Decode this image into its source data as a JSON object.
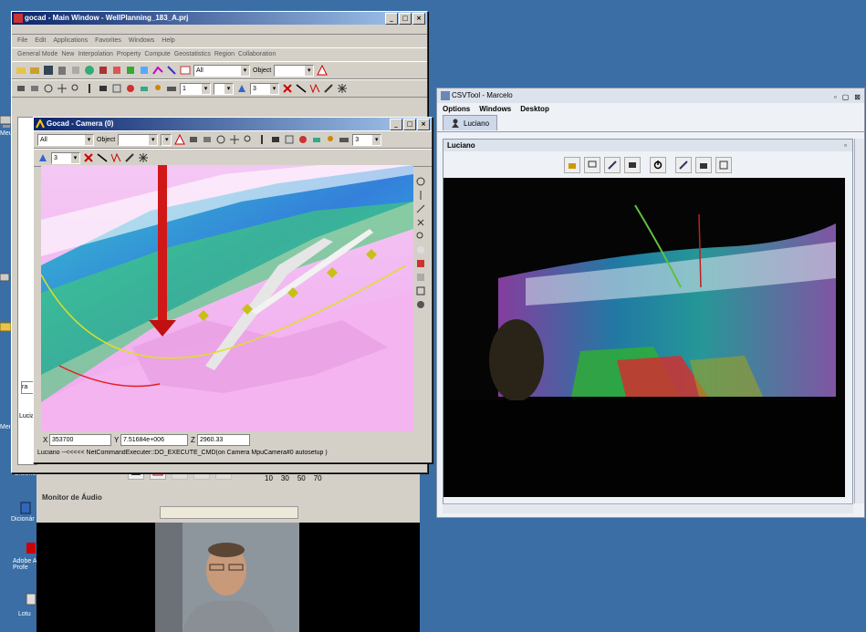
{
  "gocad_main": {
    "title": "gocad - Main Window - WellPlanning_183_A.prj",
    "menu": [
      "File",
      "Edit",
      "Applications",
      "Favorites",
      "Windows",
      "Help"
    ],
    "modes": [
      "General Mode",
      "New",
      "Interpolation",
      "Property",
      "Compute",
      "Geostatistics",
      "Region",
      "Collaboration"
    ],
    "combo_all": "All",
    "object_label": "Object",
    "spin_value_a": "1",
    "spin_value_b": "3"
  },
  "camera": {
    "title": "Gocad - Camera (0)",
    "combo_all": "All",
    "object_label": "Object",
    "spin_value_a": "3",
    "spin_value_b": "3",
    "coords": {
      "x_label": "X",
      "x": "353700",
      "y_label": "Y",
      "y": "7.51684e+006",
      "z_label": "Z",
      "z": "2960.33"
    },
    "status": "Luciano --<<<<< NetCommandExecuter::DO_EXECUTE_CMD(on Camera MpuCamera#0 autosetup )"
  },
  "csvtool": {
    "title": "CSVTool - Marcelo",
    "menu": [
      "Options",
      "Windows",
      "Desktop"
    ],
    "tab": "Luciano",
    "inner_title": "Luciano"
  },
  "audio": {
    "slider_ticks": [
      "10",
      "30",
      "50",
      "70"
    ],
    "monitor_label": "Monitor de Áudio"
  },
  "behind": {
    "tab_partial": "ra",
    "luciano_partial": "Lucia"
  },
  "desktop_icons": [
    {
      "label": "Meu\ncomp"
    },
    {
      "label": "Mei\ndo Redi"
    },
    {
      "label": "Dicioná"
    },
    {
      "label": "Dicionár"
    },
    {
      "label": "Adobe A\nProfe"
    },
    {
      "label": "Lotu"
    }
  ],
  "colors": {
    "desktop": "#3a6ea5",
    "titlebar": "#0a246a",
    "window_face": "#d4d0c8"
  }
}
